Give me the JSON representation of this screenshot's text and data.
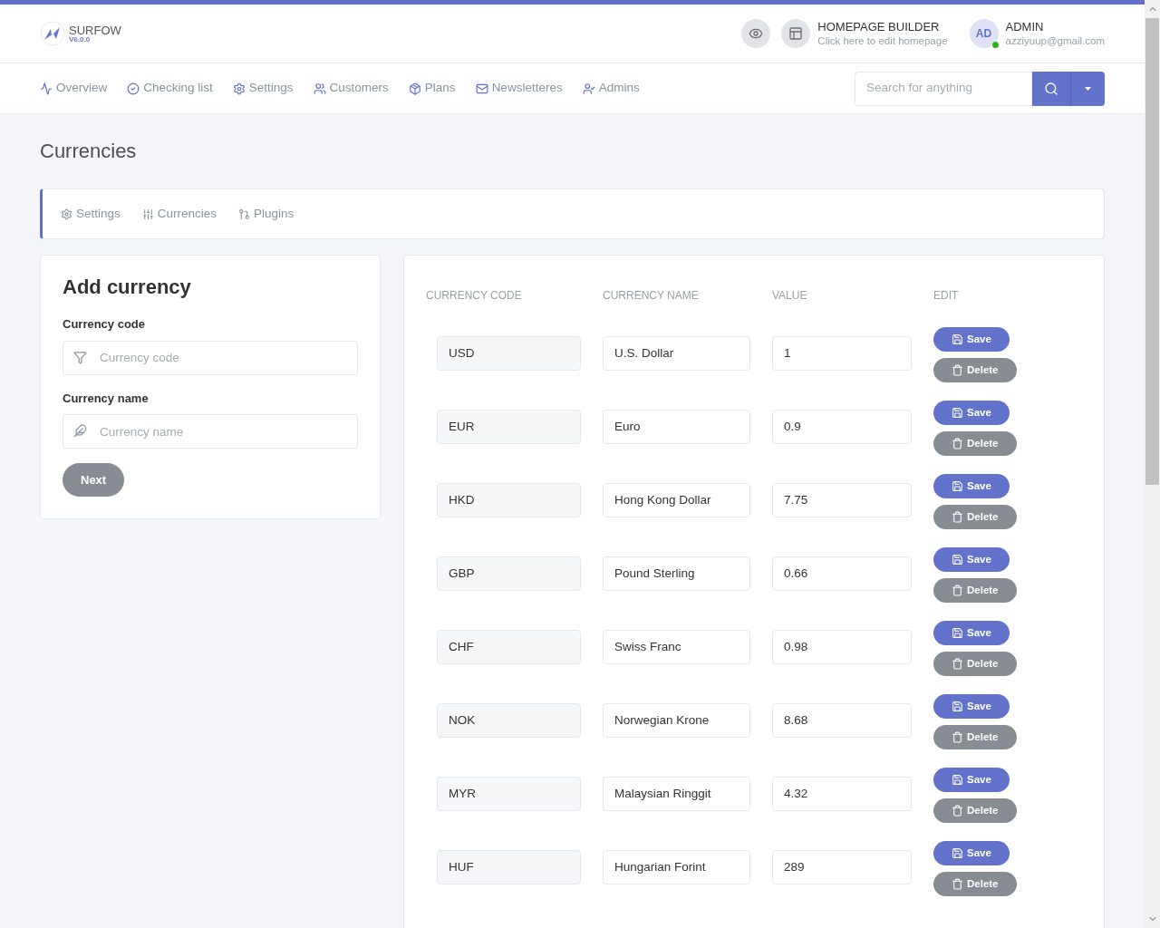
{
  "brand": {
    "name": "SURFOW",
    "version": "V6.0.0"
  },
  "builder": {
    "title": "HOMEPAGE BUILDER",
    "subtitle": "Click here to edit homepage"
  },
  "user": {
    "initials": "AD",
    "name": "ADMIN",
    "email": "azziyuup@gmail.com",
    "online": true
  },
  "nav": {
    "items": [
      {
        "label": "Overview"
      },
      {
        "label": "Checking list"
      },
      {
        "label": "Settings"
      },
      {
        "label": "Customers"
      },
      {
        "label": "Plans"
      },
      {
        "label": "Newsletteres"
      },
      {
        "label": "Admins"
      }
    ]
  },
  "search": {
    "placeholder": "Search for anything"
  },
  "page_title": "Currencies",
  "subtabs": [
    {
      "label": "Settings"
    },
    {
      "label": "Currencies"
    },
    {
      "label": "Plugins"
    }
  ],
  "add_form": {
    "title": "Add currency",
    "fields": [
      {
        "label": "Currency code",
        "placeholder": "Currency code"
      },
      {
        "label": "Currency name",
        "placeholder": "Currency name"
      }
    ],
    "button": "Next"
  },
  "table": {
    "columns": [
      "CURRENCY CODE",
      "CURRENCY NAME",
      "VALUE",
      "EDIT"
    ],
    "rows": [
      {
        "code": "USD",
        "name": "U.S. Dollar",
        "value": "1",
        "save": "Save",
        "delete": "Delete"
      },
      {
        "code": "EUR",
        "name": "Euro",
        "value": "0.9",
        "save": "Save",
        "delete": "Delete"
      },
      {
        "code": "HKD",
        "name": "Hong Kong Dollar",
        "value": "7.75",
        "save": "Save",
        "delete": "Delete"
      },
      {
        "code": "GBP",
        "name": "Pound Sterling",
        "value": "0.66",
        "save": "Save",
        "delete": "Delete"
      },
      {
        "code": "CHF",
        "name": "Swiss Franc",
        "value": "0.98",
        "save": "Save",
        "delete": "Delete"
      },
      {
        "code": "NOK",
        "name": "Norwegian Krone",
        "value": "8.68",
        "save": "Save",
        "delete": "Delete"
      },
      {
        "code": "MYR",
        "name": "Malaysian Ringgit",
        "value": "4.32",
        "save": "Save",
        "delete": "Delete"
      },
      {
        "code": "HUF",
        "name": "Hungarian Forint",
        "value": "289",
        "save": "Save",
        "delete": "Delete"
      }
    ]
  }
}
